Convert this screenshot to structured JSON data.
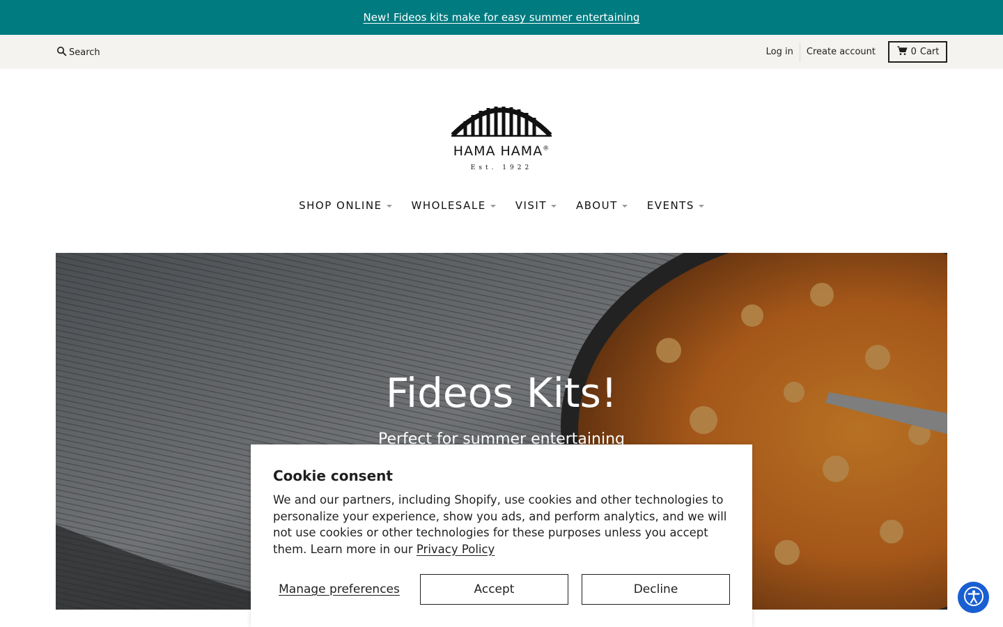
{
  "announcement": {
    "text": "New! Fideos kits make for easy summer entertaining"
  },
  "utility": {
    "search_label": "Search",
    "login_label": "Log in",
    "create_account_label": "Create account",
    "cart_count": "0",
    "cart_label": "Cart"
  },
  "logo": {
    "name": "HAMA HAMA",
    "registered": "®",
    "established": "Est. 1922"
  },
  "nav": {
    "items": [
      {
        "label": "SHOP ONLINE"
      },
      {
        "label": "WHOLESALE"
      },
      {
        "label": "VISIT"
      },
      {
        "label": "ABOUT"
      },
      {
        "label": "EVENTS"
      }
    ]
  },
  "hero": {
    "title": "Fideos Kits!",
    "subtitle": "Perfect for summer entertaining"
  },
  "cookie": {
    "title": "Cookie consent",
    "body": "We and our partners, including Shopify, use cookies and other technologies to personalize your experience, show you ads, and perform analytics, and we will not use cookies or other technologies for these purposes unless you accept them. Learn more in our",
    "privacy_link": "Privacy Policy",
    "manage_label": "Manage preferences",
    "accept_label": "Accept",
    "decline_label": "Decline"
  },
  "colors": {
    "announcement_bg": "#007b80",
    "utility_bg": "#f4f3f0",
    "accessibility_button": "#1a5fd1"
  },
  "icons": [
    "search-icon",
    "cart-icon",
    "chevron-down-icon",
    "accessibility-icon"
  ]
}
